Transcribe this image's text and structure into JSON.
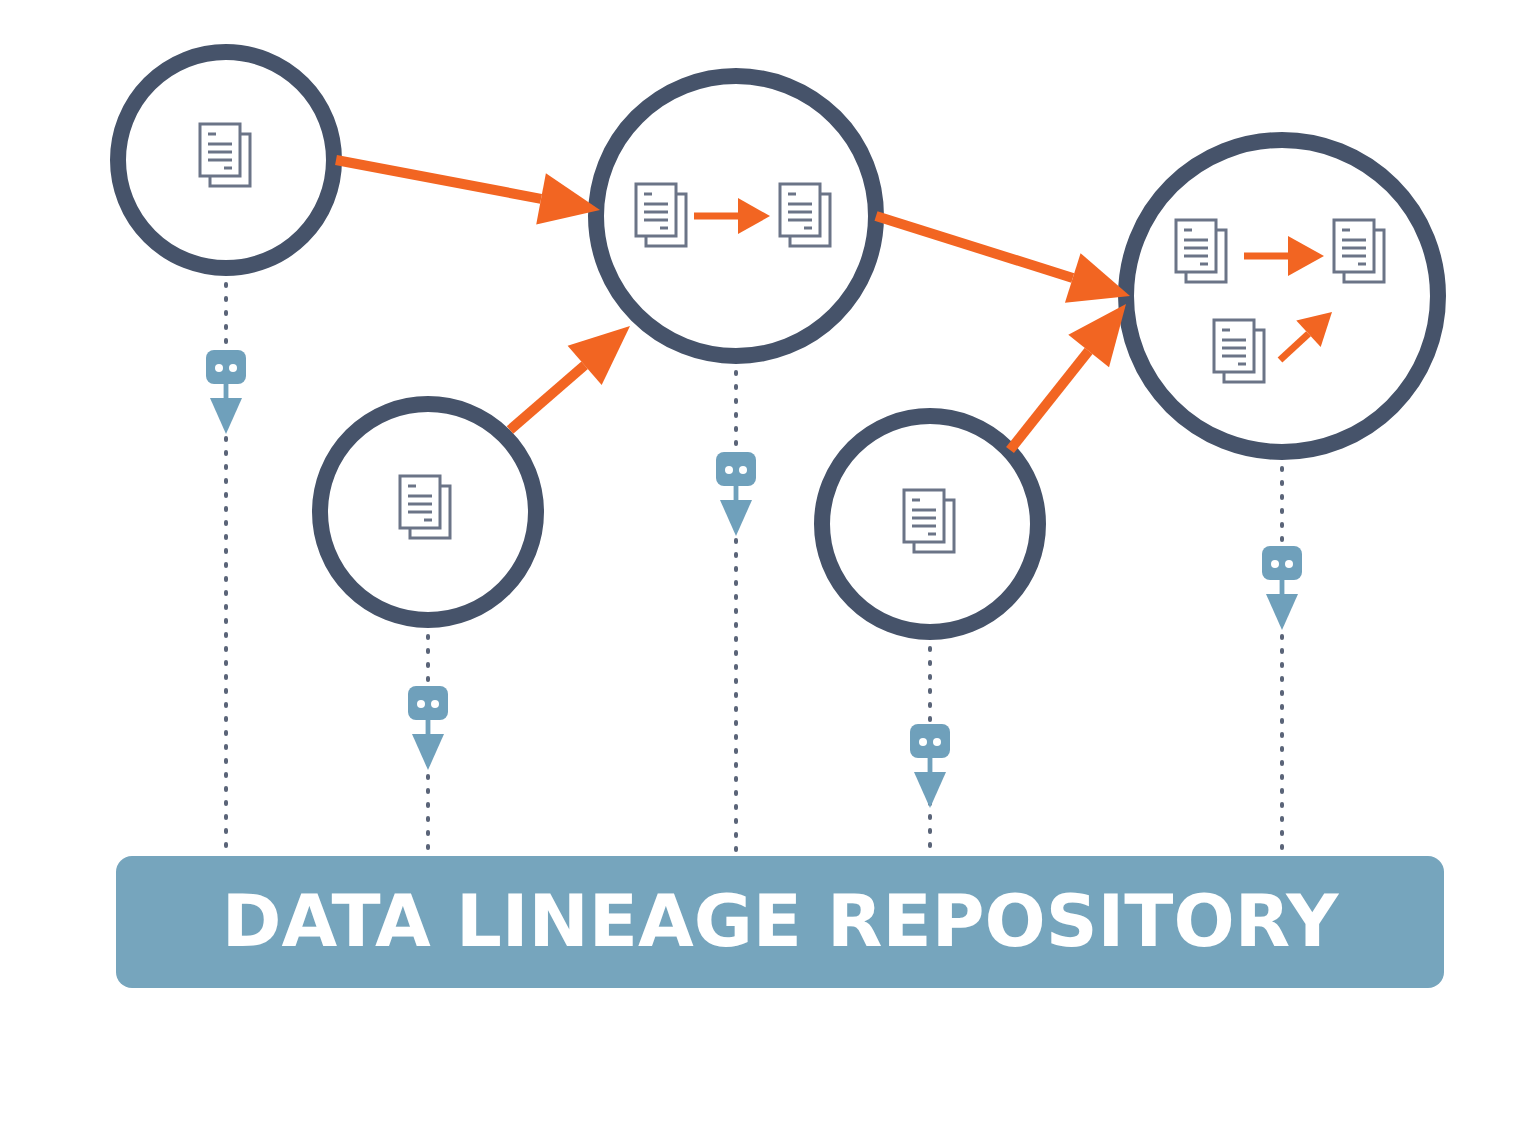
{
  "repository": {
    "label": "DATA LINEAGE REPOSITORY"
  }
}
